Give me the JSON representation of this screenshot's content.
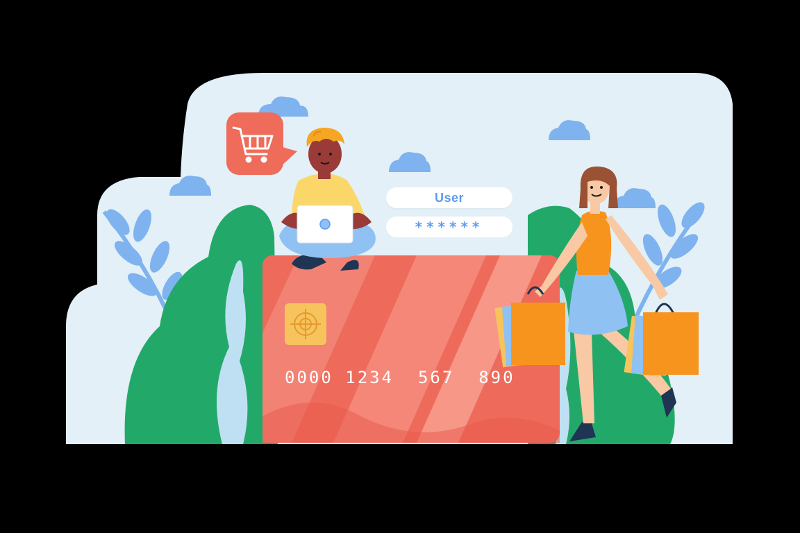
{
  "login": {
    "username_label": "User",
    "password_mask": "******"
  },
  "card": {
    "number": "0000 1234  567  890"
  },
  "colors": {
    "sky": "#e3f0f7",
    "card": "#ee6b5b",
    "leaf_green": "#22a96a",
    "leaf_blue": "#7eb3ef",
    "accent_blue": "#5b9bf2",
    "cart_bubble": "#ef6b5a",
    "chip": "#f7c35d"
  },
  "icons": [
    "shopping-cart-icon",
    "cloud-icon",
    "leaf-icon",
    "laptop-icon",
    "shopping-bag-icon",
    "card-chip-icon"
  ]
}
